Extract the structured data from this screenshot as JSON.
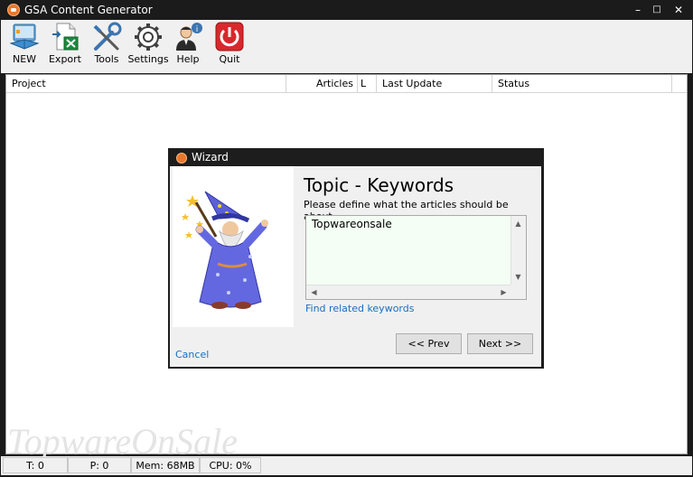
{
  "window": {
    "title": "GSA Content Generator",
    "minimize": "–",
    "maximize": "□",
    "close": "✕"
  },
  "toolbar": {
    "buttons": [
      {
        "label": "NEW",
        "icon": "new-project-icon"
      },
      {
        "label": "Export",
        "icon": "excel-export-icon"
      },
      {
        "label": "Tools",
        "icon": "tools-icon"
      },
      {
        "label": "Settings",
        "icon": "gear-icon"
      },
      {
        "label": "Help",
        "icon": "help-person-icon"
      },
      {
        "label": "Quit",
        "icon": "power-icon"
      }
    ]
  },
  "table": {
    "columns": [
      "Project",
      "Articles",
      "L",
      "Last Update",
      "Status"
    ],
    "rows": []
  },
  "watermark": "TopwareOnSale",
  "statusbar": {
    "threads": "T: 0",
    "projects": "P: 0",
    "memory": "Mem: 68MB",
    "cpu": "CPU: 0%"
  },
  "dialog": {
    "title": "Wizard",
    "heading": "Topic - Keywords",
    "description": "Please define what the articles should be about.",
    "keywords_value": "Topwareonsale",
    "find_link": "Find related keywords",
    "cancel": "Cancel",
    "prev_button": "<< Prev",
    "next_button": "Next >>"
  },
  "colors": {
    "accent_link": "#1a6fc0",
    "quit_red": "#d8282c",
    "keyword_bg": "#f4fef4"
  }
}
